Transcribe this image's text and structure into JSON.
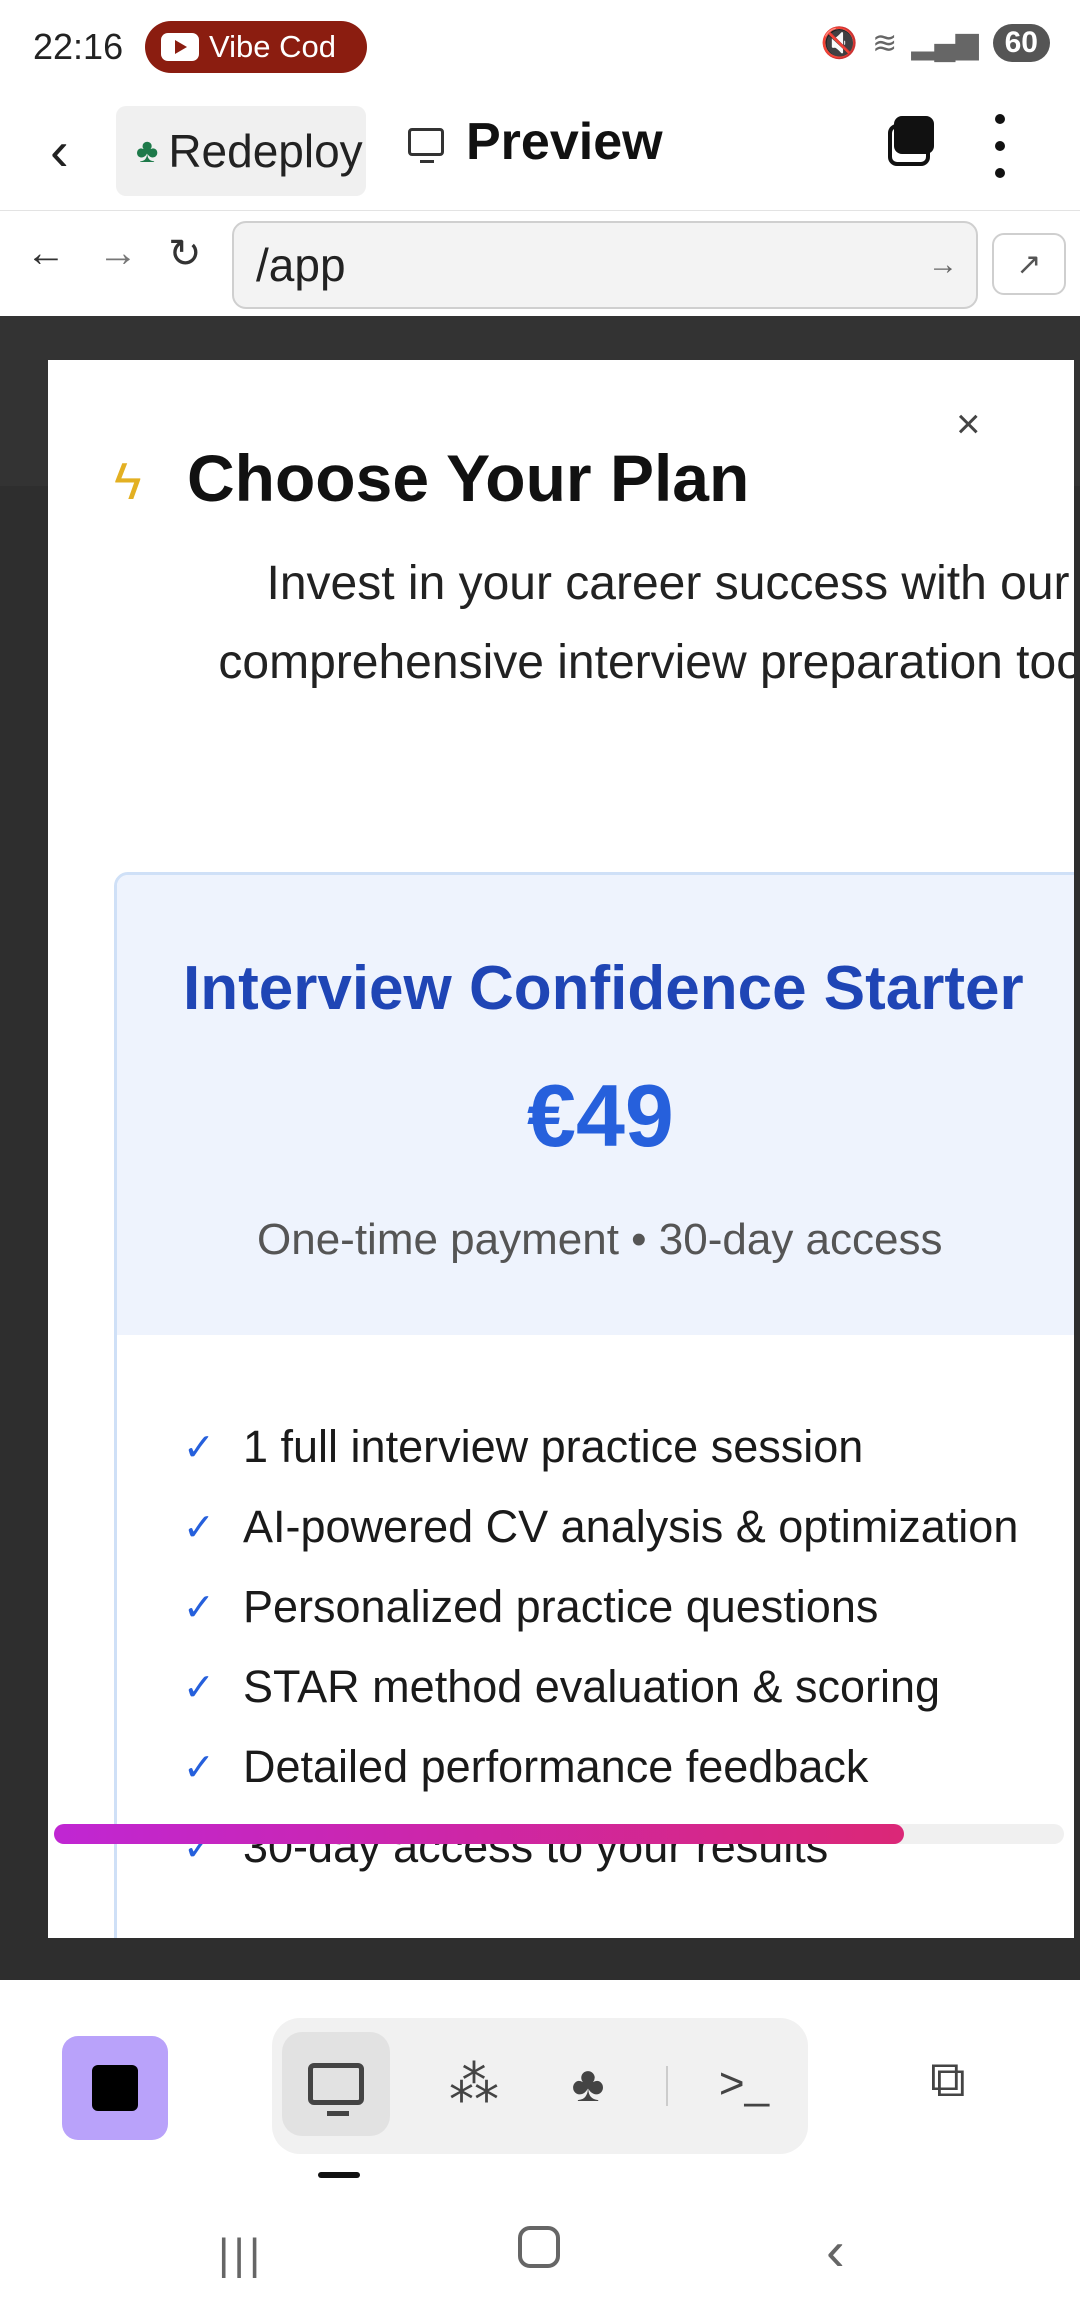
{
  "status_bar": {
    "time": "22:16",
    "media_pill": "Vibe Cod",
    "battery": "60",
    "icons": [
      "mute-icon",
      "wifi-icon",
      "signal-icon",
      "signal-icon"
    ]
  },
  "app_bar": {
    "back_label": "‹",
    "redeploy_tab": "Redeploy",
    "preview_tab": "Preview"
  },
  "browser": {
    "url": "/app"
  },
  "modal": {
    "title": "Choose Your Plan",
    "subtitle": "Invest in your career success with our comprehensive interview preparation tools",
    "close": "×"
  },
  "plan": {
    "name": "Interview Confidence Starter",
    "price": "€49",
    "note": "One-time payment • 30-day access",
    "features": [
      "1 full interview practice session",
      "AI-powered CV analysis & optimization",
      "Personalized practice questions",
      "STAR method evaluation & scoring",
      "Detailed performance feedback",
      "30-day access to your results"
    ]
  },
  "colors": {
    "accent_purple": "#b9a2fa",
    "plan_blue": "#1f45b5",
    "price_blue": "#2660dc",
    "scroll_gradient_start": "#a855f7",
    "scroll_gradient_end": "#ec4899"
  }
}
